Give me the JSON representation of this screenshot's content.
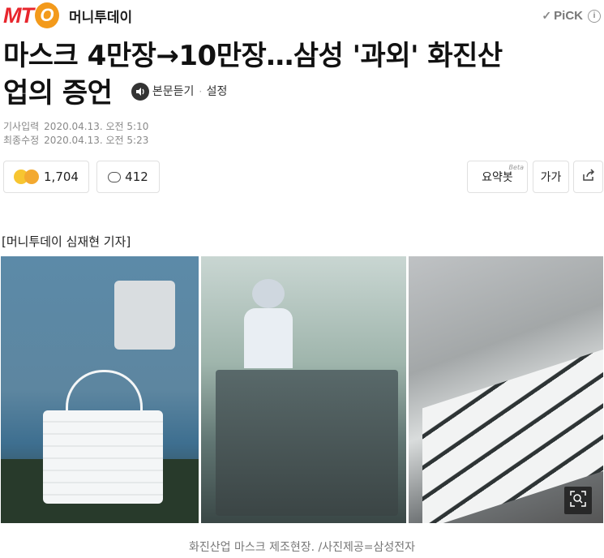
{
  "header": {
    "logo_mt": "MT",
    "logo_o": "O",
    "brand_name": "머니투데이",
    "pick_label": "PiCK",
    "pick_check_icon": "check-icon",
    "pick_info_icon": "info-icon"
  },
  "article": {
    "title_line1": "마스크 4만장→10만장…삼성 '과외' 화진산",
    "title_line2": "업의 증언",
    "listen_label": "본문듣기",
    "settings_label": "설정",
    "meta": {
      "published_label": "기사입력",
      "published_value": "2020.04.13. 오전 5:10",
      "modified_label": "최종수정",
      "modified_value": "2020.04.13. 오전 5:23"
    },
    "byline": "[머니투데이 심재현 기자]",
    "caption": "화진산업 마스크 제조현장. /사진제공=삼성전자"
  },
  "actions": {
    "reaction_count": "1,704",
    "comment_count": "412",
    "summary_label": "요약봇",
    "summary_badge": "Beta",
    "font_label": "가가"
  },
  "colors": {
    "brand_red": "#e8262d",
    "brand_orange": "#f39a1b"
  }
}
